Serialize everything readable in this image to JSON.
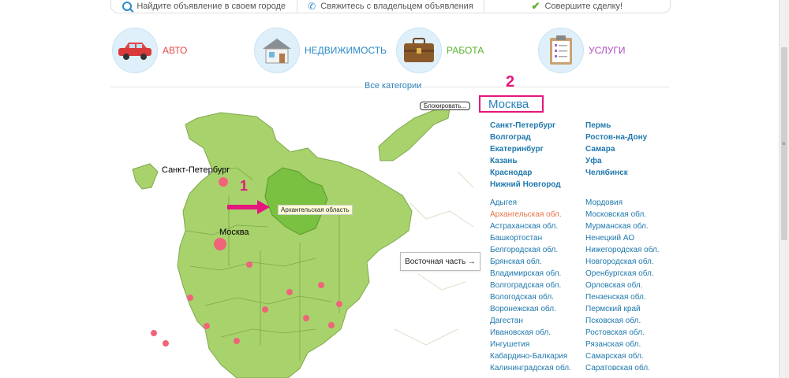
{
  "topbar": [
    {
      "text": "Найдите объявление в своем городе",
      "icon": "search-icon"
    },
    {
      "text": "Свяжитесь с владельцем объявления",
      "icon": "phone-icon"
    },
    {
      "text": "Совершите сделку!",
      "icon": "check-icon"
    }
  ],
  "categories": [
    {
      "label": "АВТО",
      "color": "#e34b4b",
      "icon": "car-icon"
    },
    {
      "label": "НЕДВИЖИМОСТЬ",
      "color": "#2a8bc9",
      "icon": "house-icon"
    },
    {
      "label": "РАБОТА",
      "color": "#5ab22e",
      "icon": "briefcase-icon"
    },
    {
      "label": "УСЛУГИ",
      "color": "#b04cc2",
      "icon": "clipboard-icon"
    }
  ],
  "all_categories": "Все категории",
  "map": {
    "labels": {
      "spb": "Санкт-Петербург",
      "moscow": "Москва"
    },
    "tooltip": "Архангельская область",
    "block_btn": "Блокировать...",
    "east_btn": "Восточная часть →",
    "annotation1": "1",
    "annotation2": "2"
  },
  "selected_city": "Москва",
  "big_cities_col1": [
    "Санкт-Петербург",
    "Волгоград",
    "Екатеринбург",
    "Казань",
    "Краснодар",
    "Нижний Новгород"
  ],
  "big_cities_col2": [
    "Пермь",
    "Ростов-на-Дону",
    "Самара",
    "Уфа",
    "Челябинск"
  ],
  "regions_col1": [
    "Адыгея",
    "Архангельская обл.",
    "Астраханская обл.",
    "Башкортостан",
    "Белгородская обл.",
    "Брянская обл.",
    "Владимирская обл.",
    "Волгоградская обл.",
    "Вологодская обл.",
    "Воронежская обл.",
    "Дагестан",
    "Ивановская обл.",
    "Ингушетия",
    "Кабардино-Балкария",
    "Калининградская обл."
  ],
  "regions_col2": [
    "Мордовия",
    "Московская обл.",
    "Мурманская обл.",
    "Ненецкий АО",
    "Нижегородская обл.",
    "Новгородская обл.",
    "Оренбургская обл.",
    "Орловская обл.",
    "Пензенская обл.",
    "Пермский край",
    "Псковская обл.",
    "Ростовская обл.",
    "Рязанская обл.",
    "Самарская обл.",
    "Саратовская обл."
  ],
  "selected_region": "Архангельская обл."
}
